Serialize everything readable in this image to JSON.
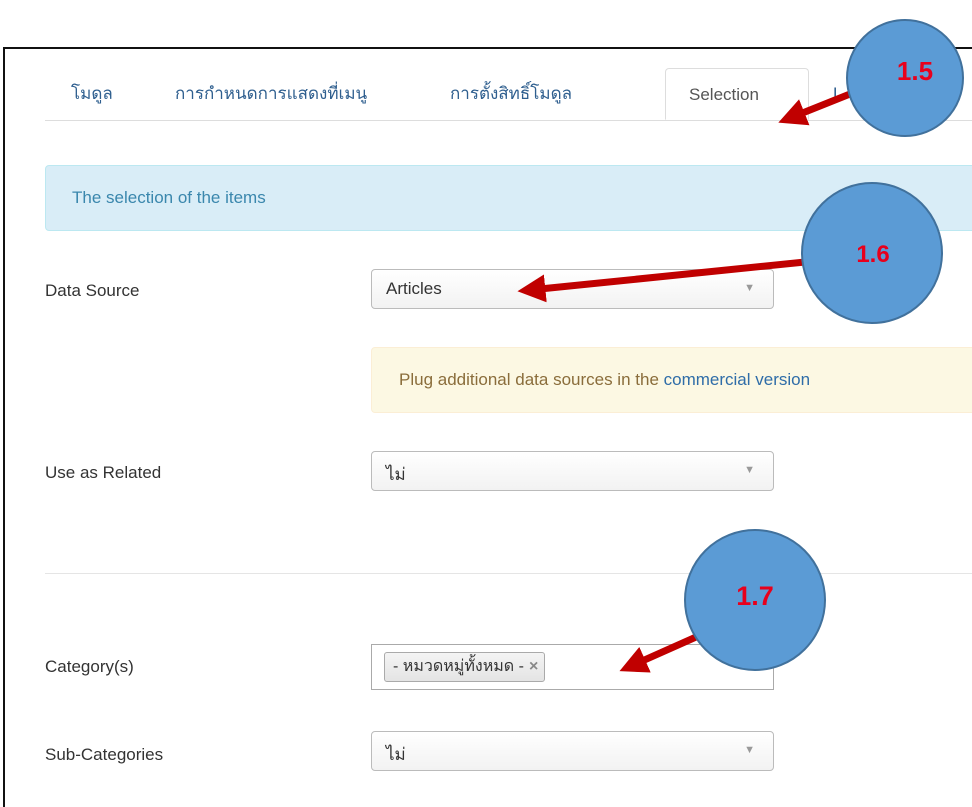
{
  "tabs": [
    {
      "label": "โมดูล"
    },
    {
      "label": "การกำหนดการแสดงที่เมนู"
    },
    {
      "label": "การตั้งสิทธิ์โมดูล"
    },
    {
      "label": "Selection"
    },
    {
      "label": "L"
    }
  ],
  "active_tab": "Selection",
  "info_banner": {
    "text": "The selection of the items"
  },
  "data_source": {
    "label": "Data Source",
    "value": "Articles"
  },
  "notice": {
    "prefix": "Plug additional data sources in the ",
    "link": "commercial version"
  },
  "use_as_related": {
    "label": "Use as Related",
    "value": "ไม่"
  },
  "categories": {
    "label": "Category(s)",
    "chip": "- หมวดหมู่ทั้งหมด -",
    "remove_symbol": "×"
  },
  "sub_categories": {
    "label": "Sub-Categories",
    "value": "ไม่"
  },
  "caret_symbol": "▼",
  "annotations": [
    {
      "label": "1.5",
      "color": "#e8001c"
    },
    {
      "label": "1.6",
      "color": "#e8001c"
    },
    {
      "label": "1.7",
      "color": "#e8001c"
    }
  ],
  "colors": {
    "bubble_fill": "#5b9bd5",
    "bubble_stroke": "#41719c",
    "arrow": "#c00000",
    "info_bg": "#d9edf7",
    "warn_bg": "#fcf8e3",
    "link": "#2f5f8f"
  }
}
